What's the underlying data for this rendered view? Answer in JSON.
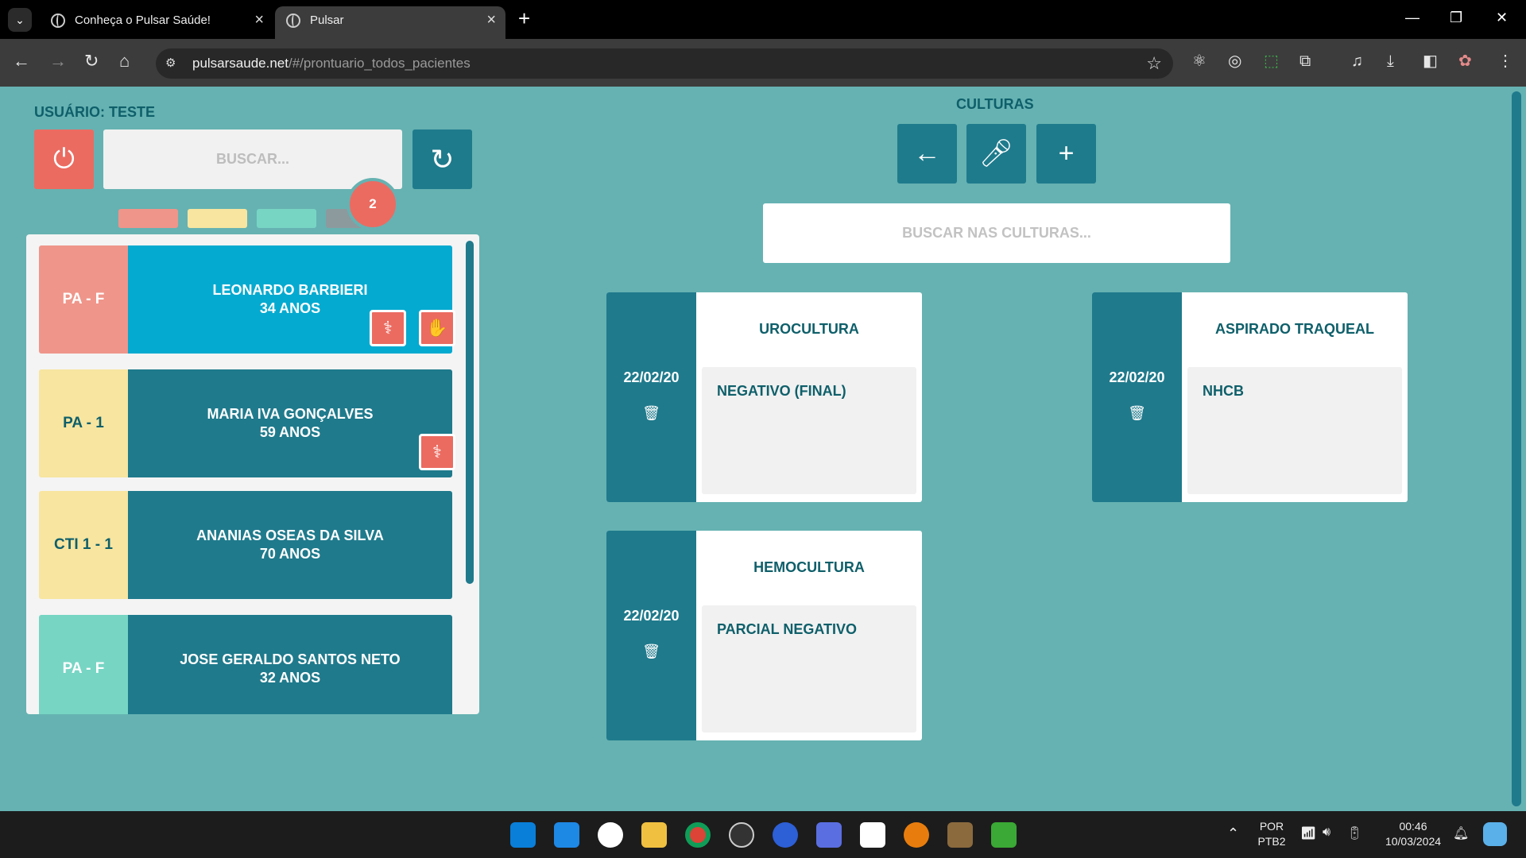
{
  "browser": {
    "tabs": [
      {
        "title": "Conheça o Pulsar Saúde!",
        "active": false
      },
      {
        "title": "Pulsar",
        "active": true
      }
    ],
    "url_host": "pulsarsaude.net",
    "url_path": "/#/prontuario_todos_pacientes"
  },
  "sidebar": {
    "user_label": "USUÁRIO: TESTE",
    "search_placeholder": "BUSCAR...",
    "badge_count": "2",
    "patients": [
      {
        "bed": "PA - F",
        "name": "LEONARDO BARBIERI",
        "age": "34 ANOS"
      },
      {
        "bed": "PA - 1",
        "name": "MARIA IVA GONÇALVES",
        "age": "59 ANOS"
      },
      {
        "bed": "CTI 1 - 1",
        "name": "ANANIAS OSEAS DA SILVA",
        "age": "70 ANOS"
      },
      {
        "bed": "PA - F",
        "name": "JOSE GERALDO SANTOS NETO",
        "age": "32 ANOS"
      },
      {
        "bed": "",
        "name": "",
        "age": ""
      }
    ]
  },
  "main": {
    "title": "CULTURAS",
    "search_placeholder": "BUSCAR NAS CULTURAS...",
    "cultures": [
      {
        "date": "22/02/20",
        "title": "UROCULTURA",
        "result": "NEGATIVO (FINAL)"
      },
      {
        "date": "22/02/20",
        "title": "ASPIRADO TRAQUEAL",
        "result": "NHCB"
      },
      {
        "date": "22/02/20",
        "title": "HEMOCULTURA",
        "result": "PARCIAL NEGATIVO"
      }
    ]
  },
  "taskbar": {
    "language": "POR",
    "layout": "PTB2",
    "time": "00:46",
    "date": "10/03/2024"
  },
  "colors": {
    "background": "#66b2b2",
    "primary": "#1f7a8c",
    "accent_red": "#eb6b61",
    "text_dark": "#0e5f6a"
  }
}
